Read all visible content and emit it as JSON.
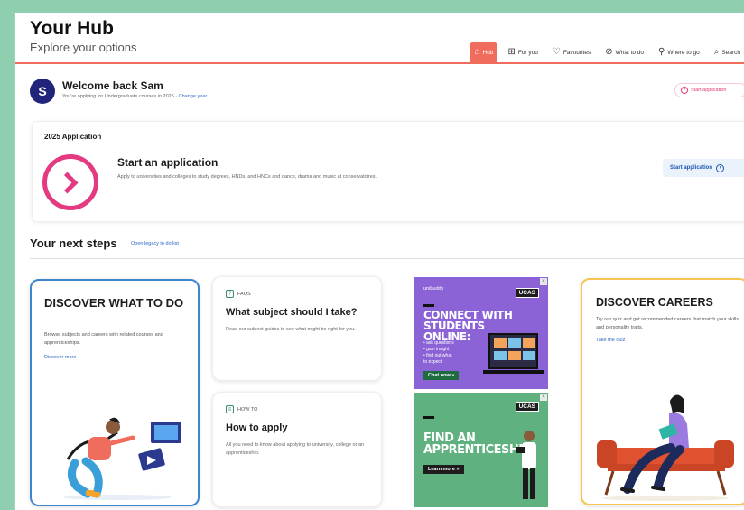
{
  "header": {
    "title": "Your Hub",
    "subtitle": "Explore your options",
    "nav": [
      {
        "label": "Hub",
        "icon": "home-icon",
        "active": true
      },
      {
        "label": "For you",
        "icon": "grid-icon",
        "active": false
      },
      {
        "label": "Favourites",
        "icon": "heart-icon",
        "active": false
      },
      {
        "label": "What to do",
        "icon": "compass-icon",
        "active": false
      },
      {
        "label": "Where to go",
        "icon": "location-pin-icon",
        "active": false
      },
      {
        "label": "Search",
        "icon": "search-icon",
        "active": false
      }
    ]
  },
  "welcome": {
    "avatar_initial": "S",
    "greeting": "Welcome back Sam",
    "applying_text": "You're applying for Undergraduate courses in 2025 ·",
    "change_link": "Change year",
    "start_button": "Start application"
  },
  "application": {
    "year_label": "2025 Application",
    "heading": "Start an application",
    "description": "Apply to universities and colleges to study degrees, HNDs, and HNCs and dance, drama and music at conservatoires.",
    "button": "Start application"
  },
  "next_steps": {
    "heading": "Your next steps",
    "link": "Open legacy to do list"
  },
  "cards": {
    "discover": {
      "title": "DISCOVER WHAT TO DO",
      "description": "Browse subjects and careers with related courses and apprenticeships.",
      "link": "Discover more"
    },
    "faq": {
      "tag": "FAQS",
      "title": "What subject should I take?",
      "description": "Read our subject guides to see what might be right for you."
    },
    "howto": {
      "tag": "HOW TO",
      "title": "How to apply",
      "description": "All you need to know about applying to university, college or an apprenticeship."
    },
    "careers": {
      "title": "DISCOVER CAREERS",
      "description": "Try our quiz and get recommended careers that match your skills and personality traits.",
      "link": "Take the quiz"
    }
  },
  "ads": {
    "online": {
      "brand": "unibuddy",
      "badge": "UCAS",
      "headline": "CONNECT WITH STUDENTS ONLINE:",
      "bullets": [
        "• ask questions",
        "• gain insight",
        "• find out what",
        "  to expect"
      ],
      "button": "Chat now »"
    },
    "apprenticeship": {
      "badge": "UCAS",
      "headline": "FIND AN APPRENTICESHIP",
      "button": "Learn more »"
    }
  },
  "colors": {
    "accent": "#f06c5c",
    "pink": "#e43a7f",
    "link": "#2f68c0",
    "avatar": "#20247a",
    "discover_border": "#3d86cf",
    "careers_border": "#f6c552"
  }
}
